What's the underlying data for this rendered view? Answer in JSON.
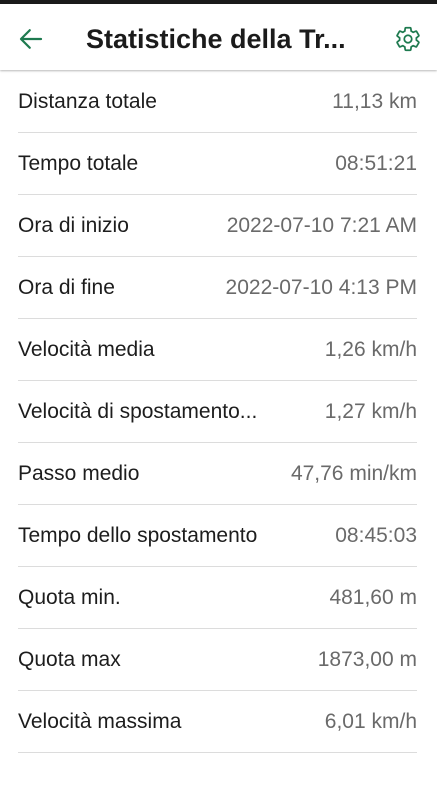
{
  "app_bar": {
    "title": "Statistiche della Tr...",
    "back_icon": "arrow-left-icon",
    "settings_icon": "gear-icon",
    "accent_color": "#1e7a4f"
  },
  "stats": [
    {
      "label": "Distanza totale",
      "value": "11,13 km"
    },
    {
      "label": "Tempo totale",
      "value": "08:51:21"
    },
    {
      "label": "Ora di inizio",
      "value": "2022-07-10 7:21 AM"
    },
    {
      "label": "Ora di fine",
      "value": "2022-07-10 4:13 PM"
    },
    {
      "label": "Velocità media",
      "value": "1,26 km/h"
    },
    {
      "label": "Velocità di spostamento...",
      "value": "1,27 km/h"
    },
    {
      "label": "Passo medio",
      "value": "47,76 min/km"
    },
    {
      "label": "Tempo dello spostamento",
      "value": "08:45:03"
    },
    {
      "label": "Quota min.",
      "value": "481,60 m"
    },
    {
      "label": "Quota max",
      "value": "1873,00 m"
    },
    {
      "label": "Velocità massima",
      "value": "6,01 km/h"
    }
  ]
}
